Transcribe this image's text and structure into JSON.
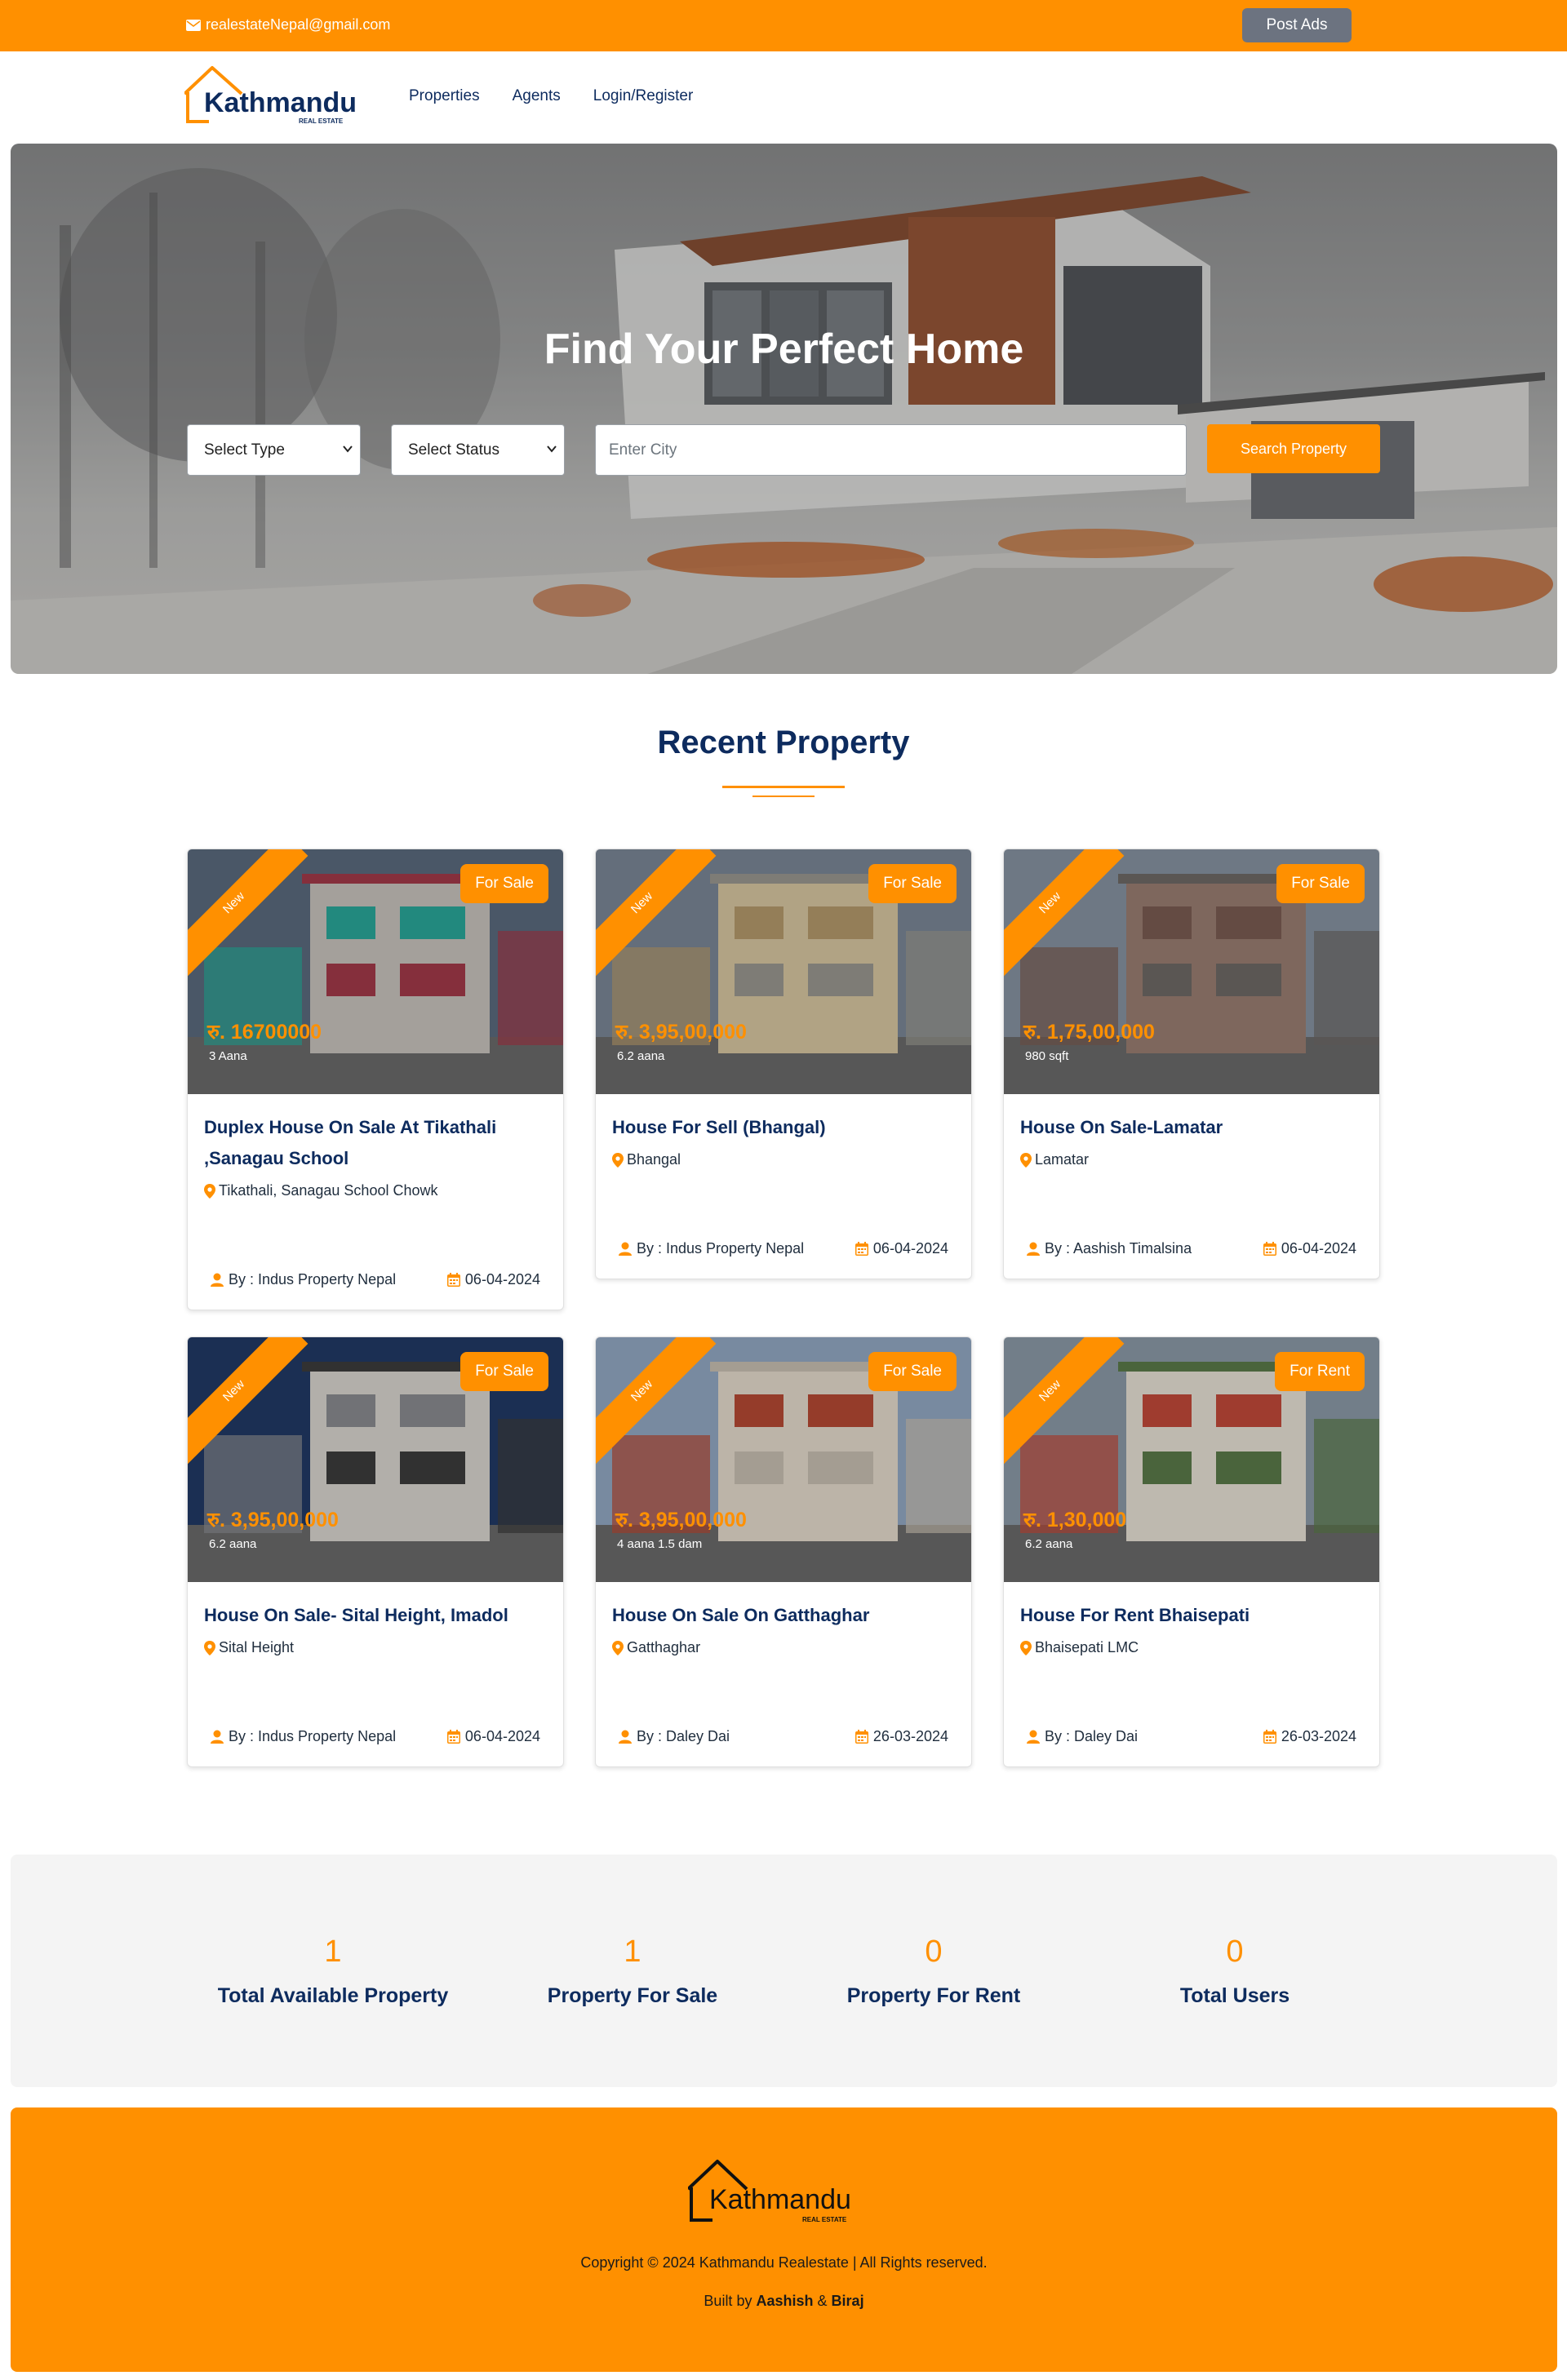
{
  "topbar": {
    "email": "realestateNepal@gmail.com",
    "post_ads": "Post Ads"
  },
  "brand": {
    "name": "Kathmandu",
    "tagline": "REAL ESTATE"
  },
  "nav": {
    "links": [
      "Properties",
      "Agents",
      "Login/Register"
    ]
  },
  "hero": {
    "title": "Find Your Perfect Home",
    "type_select": "Select Type",
    "status_select": "Select Status",
    "city_placeholder": "Enter City",
    "search_button": "Search Property"
  },
  "recent": {
    "title": "Recent Property"
  },
  "properties": [
    {
      "ribbon": "New",
      "status": "For Sale",
      "price": "रु. 16700000",
      "area": "3 Aana",
      "title": "Duplex House On Sale At Tikathali ,Sanagau School",
      "location": "Tikathali, Sanagau School Chowk",
      "agent": "By : Indus Property Nepal",
      "date": "06-04-2024"
    },
    {
      "ribbon": "New",
      "status": "For Sale",
      "price": "रु. 3,95,00,000",
      "area": "6.2 aana",
      "title": "House For Sell (Bhangal)",
      "location": "Bhangal",
      "agent": "By : Indus Property Nepal",
      "date": "06-04-2024"
    },
    {
      "ribbon": "New",
      "status": "For Sale",
      "price": "रु. 1,75,00,000",
      "area": "980 sqft",
      "title": "House On Sale-Lamatar",
      "location": "Lamatar",
      "agent": "By : Aashish Timalsina",
      "date": "06-04-2024"
    },
    {
      "ribbon": "New",
      "status": "For Sale",
      "price": "रु. 3,95,00,000",
      "area": "6.2 aana",
      "title": "House On Sale- Sital Height, Imadol",
      "location": "Sital Height",
      "agent": "By : Indus Property Nepal",
      "date": "06-04-2024"
    },
    {
      "ribbon": "New",
      "status": "For Sale",
      "price": "रु. 3,95,00,000",
      "area": "4 aana 1.5 dam",
      "title": "House On Sale On Gatthaghar",
      "location": "Gatthaghar",
      "agent": "By : Daley Dai",
      "date": "26-03-2024"
    },
    {
      "ribbon": "New",
      "status": "For Rent",
      "price": "रु. 1,30,000",
      "area": "6.2 aana",
      "title": "House For Rent Bhaisepati",
      "location": "Bhaisepati LMC",
      "agent": "By : Daley Dai",
      "date": "26-03-2024"
    }
  ],
  "stats": [
    {
      "value": "1",
      "label": "Total Available Property"
    },
    {
      "value": "1",
      "label": "Property For Sale"
    },
    {
      "value": "0",
      "label": "Property For Rent"
    },
    {
      "value": "0",
      "label": "Total Users"
    }
  ],
  "footer": {
    "copyright": "Copyright © 2024 Kathmandu Realestate | All Rights reserved.",
    "built_prefix": "Built by",
    "author1": "Aashish",
    "amp": "&",
    "author2": "Biraj"
  },
  "colors": {
    "accent": "#ff9000",
    "navy": "#0d2b5e",
    "gray_button": "#6c7380"
  }
}
